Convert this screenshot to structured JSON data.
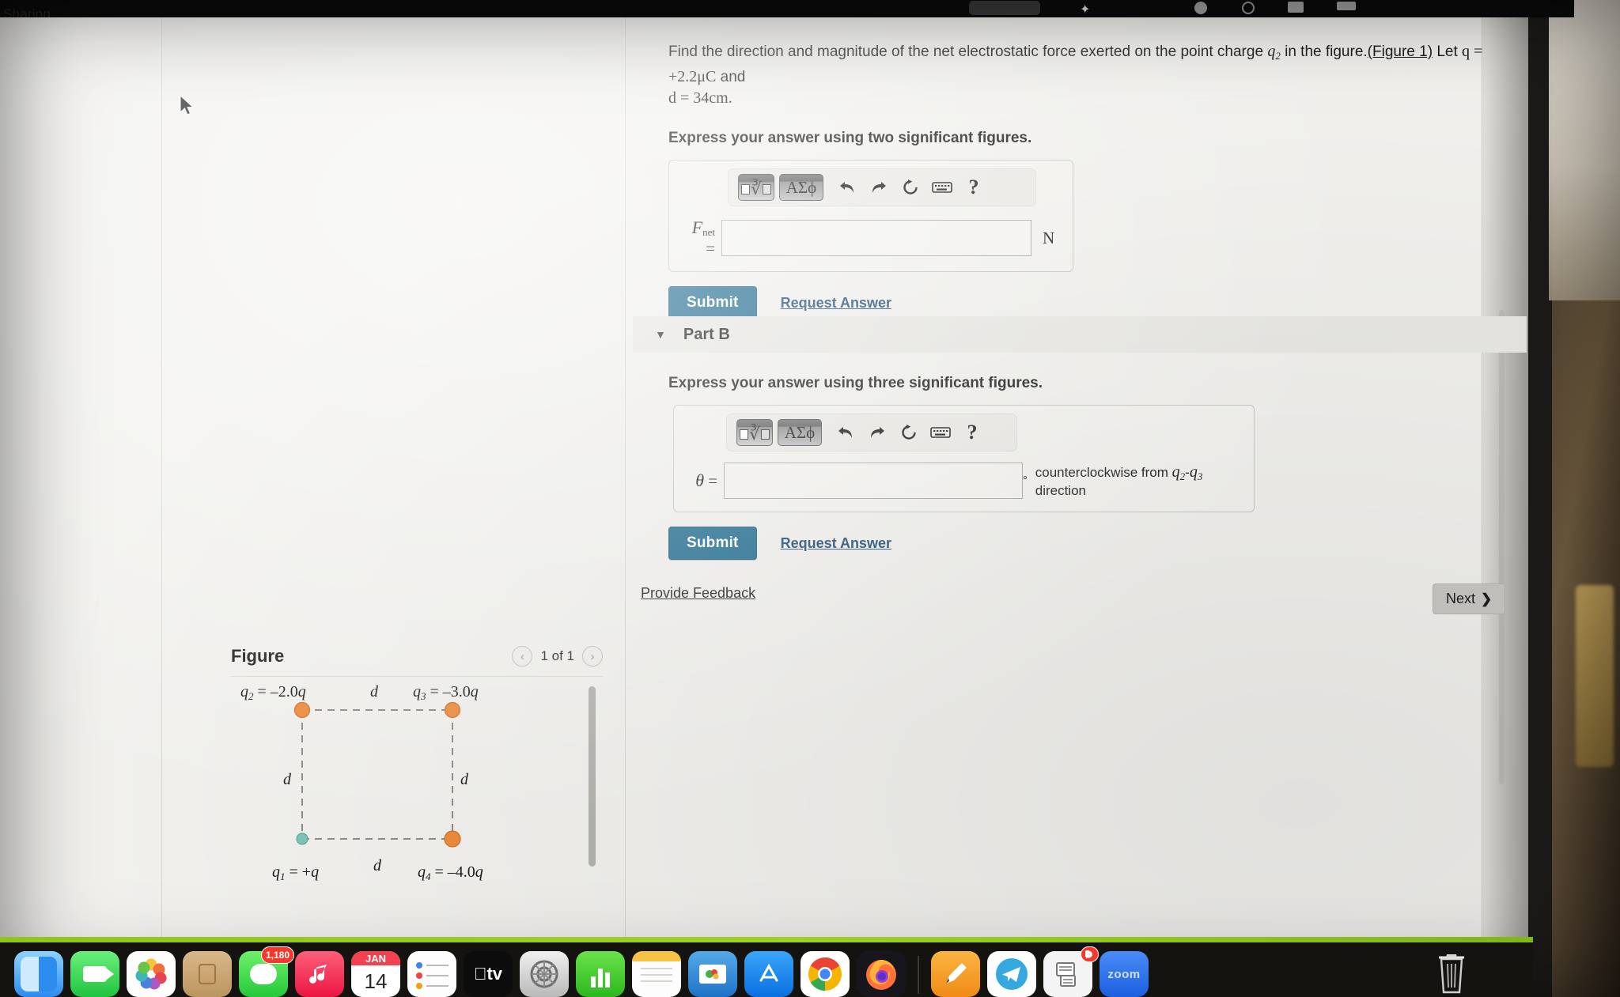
{
  "menubar": {
    "visible_label": "Sharing",
    "icons": [
      "control-center-icon",
      "siri-icon",
      "battery-icon",
      "wifi-icon"
    ]
  },
  "question": {
    "part_a": {
      "prompt_lead": "Find the direction and magnitude of the net electrostatic force exerted on the point charge",
      "charge_symbol": "q",
      "charge_sub": "2",
      "prompt_mid": "in the figure.",
      "figure_link": "(Figure 1)",
      "let_text": "Let",
      "given_q": "q = +2.2μC",
      "and_text": "and",
      "given_d": "d = 34cm.",
      "instruction": "Express your answer using two significant figures.",
      "variable_label": "F",
      "variable_sub": "net",
      "equals": "=",
      "input_value": "",
      "unit": "N",
      "submit_label": "Submit",
      "request_answer_label": "Request Answer"
    },
    "part_b": {
      "header_label": "Part B",
      "instruction": "Express your answer using three significant figures.",
      "variable_label": "θ",
      "equals": "=",
      "input_value": "",
      "degree_symbol": "°",
      "unit_note_prefix": "counterclockwise from",
      "unit_note_charge_a": "q",
      "unit_note_charge_a_sub": "2",
      "unit_note_dash": "-",
      "unit_note_charge_b": "q",
      "unit_note_charge_b_sub": "3",
      "unit_note_suffix": "direction",
      "submit_label": "Submit",
      "request_answer_label": "Request Answer"
    }
  },
  "mathbar": {
    "template_button": "template-icon",
    "greek_button": "ΑΣϕ",
    "undo_icon": "undo-arrow-icon",
    "redo_icon": "redo-arrow-icon",
    "reset_icon": "reset-circular-arrow-icon",
    "keyboard_icon": "keyboard-icon",
    "help_label": "?"
  },
  "footer": {
    "provide_feedback": "Provide Feedback",
    "next_label": "Next",
    "next_chevron": "›"
  },
  "figure": {
    "title": "Figure",
    "prev_arrow": "‹",
    "next_arrow": "›",
    "counter": "1 of 1",
    "charges": [
      {
        "id": "q2",
        "label": "q",
        "sub": "2",
        "value": "= –2.0q",
        "color": "#ed8b3c",
        "position": "top-left"
      },
      {
        "id": "q3",
        "label": "q",
        "sub": "3",
        "value": "= –3.0q",
        "color": "#ed8b3c",
        "position": "top-right"
      },
      {
        "id": "q1",
        "label": "q",
        "sub": "1",
        "value": "= +q",
        "color": "#7fc6b8",
        "position": "bottom-left"
      },
      {
        "id": "q4",
        "label": "q",
        "sub": "4",
        "value": "= –4.0q",
        "color": "#ed8b3c",
        "position": "bottom-right"
      }
    ],
    "side_labels": [
      "d",
      "d",
      "d",
      "d"
    ]
  },
  "dock": {
    "items": [
      {
        "name": "finder-icon",
        "color": "#2d8cf0",
        "label": ""
      },
      {
        "name": "facetime-icon",
        "color": "#41d15a",
        "label": ""
      },
      {
        "name": "photos-icon",
        "color": "#fdfdfd",
        "label": ""
      },
      {
        "name": "contacts-icon",
        "color": "#c8a271",
        "label": ""
      },
      {
        "name": "messages-icon",
        "color": "#4bdb5a",
        "label": "",
        "badge": "1,180"
      },
      {
        "name": "music-icon",
        "color": "#f5375c",
        "label": ""
      },
      {
        "name": "calendar-icon",
        "color": "#ffffff",
        "label": "JAN",
        "day": "14"
      },
      {
        "name": "reminders-icon",
        "color": "#fdfdfd",
        "label": ""
      },
      {
        "name": "apple-tv-icon",
        "color": "#0c0c0c",
        "label": "tv"
      },
      {
        "name": "system-settings-icon",
        "color": "#d6d6d6",
        "label": ""
      },
      {
        "name": "numbers-icon",
        "color": "#43d02f",
        "label": ""
      },
      {
        "name": "notes-icon",
        "color": "#fdfdfd",
        "label": ""
      },
      {
        "name": "keynote-icon",
        "color": "#2f8ddc",
        "label": ""
      },
      {
        "name": "app-store-icon",
        "color": "#1b8cf5",
        "label": ""
      },
      {
        "name": "chrome-icon",
        "color": "#ffffff",
        "label": ""
      },
      {
        "name": "firefox-icon",
        "color": "#1a1a1e",
        "label": ""
      },
      {
        "name": "goodnotes-icon",
        "color": "#f5a623",
        "label": ""
      },
      {
        "name": "telegram-icon",
        "color": "#34a7e0",
        "label": ""
      },
      {
        "name": "messenger-mail-icon",
        "color": "#f2f2f2",
        "label": "",
        "badge": ""
      },
      {
        "name": "zoom-icon",
        "color": "#2d72f0",
        "label": "zoom"
      }
    ],
    "trash": "trash-icon"
  },
  "colors": {
    "submit_blue": "#1d6a8e",
    "link_blue": "#1a4a73",
    "page_bg": "#f2f1ee",
    "charge_orange": "#ed8b3c",
    "charge_teal": "#7fc6b8",
    "dock_bg": "#15130f",
    "accent_green": "#9ed128"
  }
}
